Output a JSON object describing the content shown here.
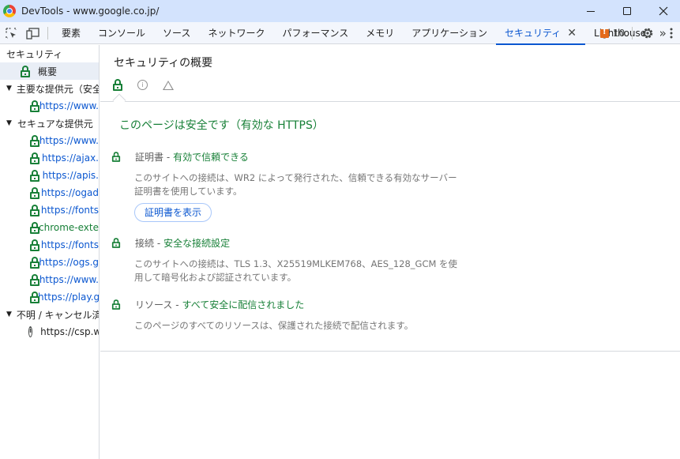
{
  "window": {
    "title": "DevTools - www.google.co.jp/"
  },
  "toolbar": {
    "tabs": [
      {
        "label": "要素"
      },
      {
        "label": "コンソール"
      },
      {
        "label": "ソース"
      },
      {
        "label": "ネットワーク"
      },
      {
        "label": "パフォーマンス"
      },
      {
        "label": "メモリ"
      },
      {
        "label": "アプリケーション"
      },
      {
        "label": "セキュリティ"
      },
      {
        "label": "Lighthouse"
      }
    ],
    "close_glyph": "✕",
    "more_glyph": "»",
    "issues_count": "10"
  },
  "sidebar": {
    "root_label": "セキュリティ",
    "overview_label": "概要",
    "main_origin_label": "主要な提供元（安全",
    "main_origin_url": "https://www.",
    "secure_label": "セキュアな提供元",
    "secure_urls": [
      "https://www.",
      "https://ajax.",
      "https://apis.",
      "https://ogad",
      "https://fonts",
      "chrome-exte",
      "https://fonts",
      "https://ogs.g",
      "https://www.",
      "https://play.g"
    ],
    "unknown_label": "不明 / キャンセル済み",
    "unknown_url": "https://csp.w"
  },
  "main": {
    "title": "セキュリティの概要",
    "summary": "このページは安全です（有効な HTTPS）",
    "certificate": {
      "label": "証明書 -",
      "value": "有効で信頼できる",
      "description": "このサイトへの接続は、WR2 によって発行された、信頼できる有効なサーバー証明書を使用しています。",
      "button": "証明書を表示"
    },
    "connection": {
      "label": "接続 -",
      "value": "安全な接続設定",
      "description": "このサイトへの接続は、TLS 1.3、X25519MLKEM768、AES_128_GCM を使用して暗号化および認証されています。"
    },
    "resources": {
      "label": "リソース -",
      "value": "すべて安全に配信されました",
      "description": "このページのすべてのリソースは、保護された接続で配信されます。"
    }
  }
}
